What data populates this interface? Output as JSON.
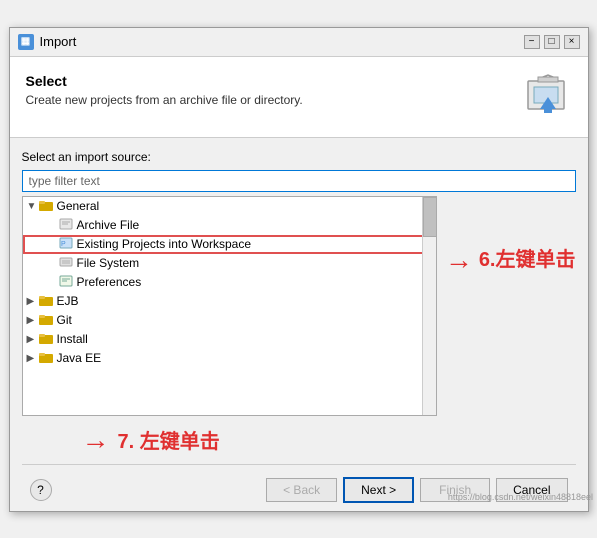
{
  "titleBar": {
    "icon": "▦",
    "title": "Import",
    "minimizeLabel": "−",
    "maximizeLabel": "□",
    "closeLabel": "×"
  },
  "header": {
    "heading": "Select",
    "description": "Create new projects from an archive file or directory."
  },
  "content": {
    "label": "Select an import source:",
    "filterPlaceholder": "type filter text",
    "treeItems": [
      {
        "indent": 0,
        "arrow": "▼",
        "icon": "📁",
        "iconClass": "folder-icon",
        "label": "General",
        "selected": false
      },
      {
        "indent": 1,
        "arrow": "",
        "icon": "📄",
        "iconClass": "file-icon",
        "label": "Archive File",
        "selected": false
      },
      {
        "indent": 1,
        "arrow": "",
        "icon": "📄",
        "iconClass": "file-icon",
        "label": "Existing Projects into Workspace",
        "selected": true
      },
      {
        "indent": 1,
        "arrow": "",
        "icon": "🖥",
        "iconClass": "file-icon",
        "label": "File System",
        "selected": false
      },
      {
        "indent": 1,
        "arrow": "",
        "icon": "📋",
        "iconClass": "file-icon",
        "label": "Preferences",
        "selected": false
      },
      {
        "indent": 0,
        "arrow": "▶",
        "icon": "📁",
        "iconClass": "folder-icon",
        "label": "EJB",
        "selected": false
      },
      {
        "indent": 0,
        "arrow": "▶",
        "icon": "📁",
        "iconClass": "folder-icon",
        "label": "Git",
        "selected": false
      },
      {
        "indent": 0,
        "arrow": "▶",
        "icon": "📁",
        "iconClass": "folder-icon",
        "label": "Install",
        "selected": false
      },
      {
        "indent": 0,
        "arrow": "▶",
        "icon": "📁",
        "iconClass": "folder-icon",
        "label": "Java EE",
        "selected": false
      }
    ]
  },
  "annotations": {
    "arrow1": "→",
    "text1": "6.左键单击",
    "arrow2": "→",
    "text2": "7. 左键单击"
  },
  "buttons": {
    "help": "?",
    "back": "< Back",
    "next": "Next >",
    "finish": "Finish",
    "cancel": "Cancel"
  },
  "watermark": "https://blog.csdn.net/weixin48818eel"
}
